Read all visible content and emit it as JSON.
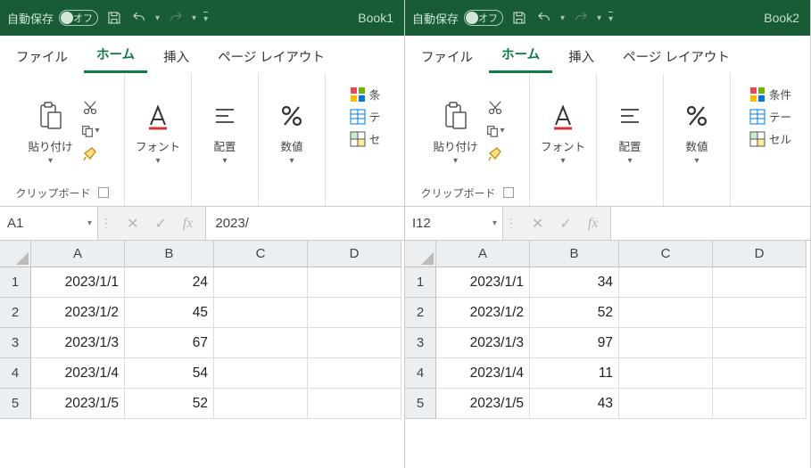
{
  "panes": [
    {
      "title": {
        "autoSave": "自動保存",
        "toggleState": "オフ",
        "book": "Book1"
      },
      "tabs": {
        "file": "ファイル",
        "home": "ホーム",
        "insert": "挿入",
        "layout": "ページ レイアウト"
      },
      "ribbon": {
        "paste": "貼り付け",
        "clipboard": "クリップボード",
        "font": "フォント",
        "align": "配置",
        "number": "数値",
        "cf1": "条",
        "cf2": "テ",
        "cf3": "セ"
      },
      "formulaBar": {
        "nameBox": "A1",
        "fx": "fx",
        "value": "2023/"
      },
      "grid": {
        "cols": [
          "A",
          "B",
          "C",
          "D"
        ],
        "rows": [
          "1",
          "2",
          "3",
          "4",
          "5"
        ],
        "cells": [
          [
            "2023/1/1",
            "24",
            "",
            ""
          ],
          [
            "2023/1/2",
            "45",
            "",
            ""
          ],
          [
            "2023/1/3",
            "67",
            "",
            ""
          ],
          [
            "2023/1/4",
            "54",
            "",
            ""
          ],
          [
            "2023/1/5",
            "52",
            "",
            ""
          ]
        ]
      }
    },
    {
      "title": {
        "autoSave": "自動保存",
        "toggleState": "オフ",
        "book": "Book2"
      },
      "tabs": {
        "file": "ファイル",
        "home": "ホーム",
        "insert": "挿入",
        "layout": "ページ レイアウト"
      },
      "ribbon": {
        "paste": "貼り付け",
        "clipboard": "クリップボード",
        "font": "フォント",
        "align": "配置",
        "number": "数値",
        "cf1": "条件",
        "cf2": "テー",
        "cf3": "セル"
      },
      "formulaBar": {
        "nameBox": "I12",
        "fx": "fx",
        "value": ""
      },
      "grid": {
        "cols": [
          "A",
          "B",
          "C",
          "D"
        ],
        "rows": [
          "1",
          "2",
          "3",
          "4",
          "5"
        ],
        "cells": [
          [
            "2023/1/1",
            "34",
            "",
            ""
          ],
          [
            "2023/1/2",
            "52",
            "",
            ""
          ],
          [
            "2023/1/3",
            "97",
            "",
            ""
          ],
          [
            "2023/1/4",
            "11",
            "",
            ""
          ],
          [
            "2023/1/5",
            "43",
            "",
            ""
          ]
        ]
      }
    }
  ]
}
